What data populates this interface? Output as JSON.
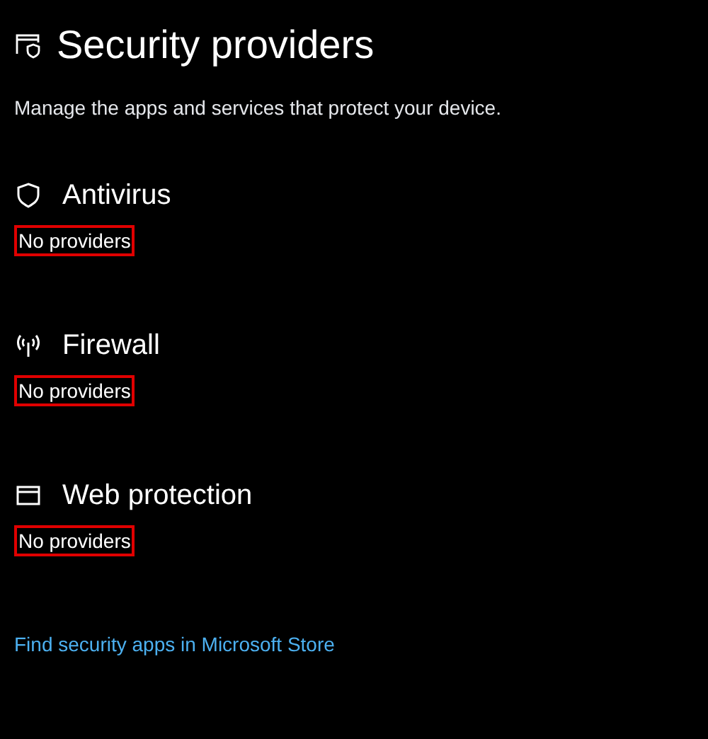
{
  "page": {
    "title": "Security providers",
    "subtitle": "Manage the apps and services that protect your device."
  },
  "sections": [
    {
      "kind": "antivirus",
      "title": "Antivirus",
      "status": "No providers"
    },
    {
      "kind": "firewall",
      "title": "Firewall",
      "status": "No providers"
    },
    {
      "kind": "web",
      "title": "Web protection",
      "status": "No providers"
    }
  ],
  "link": "Find security apps in Microsoft Store"
}
